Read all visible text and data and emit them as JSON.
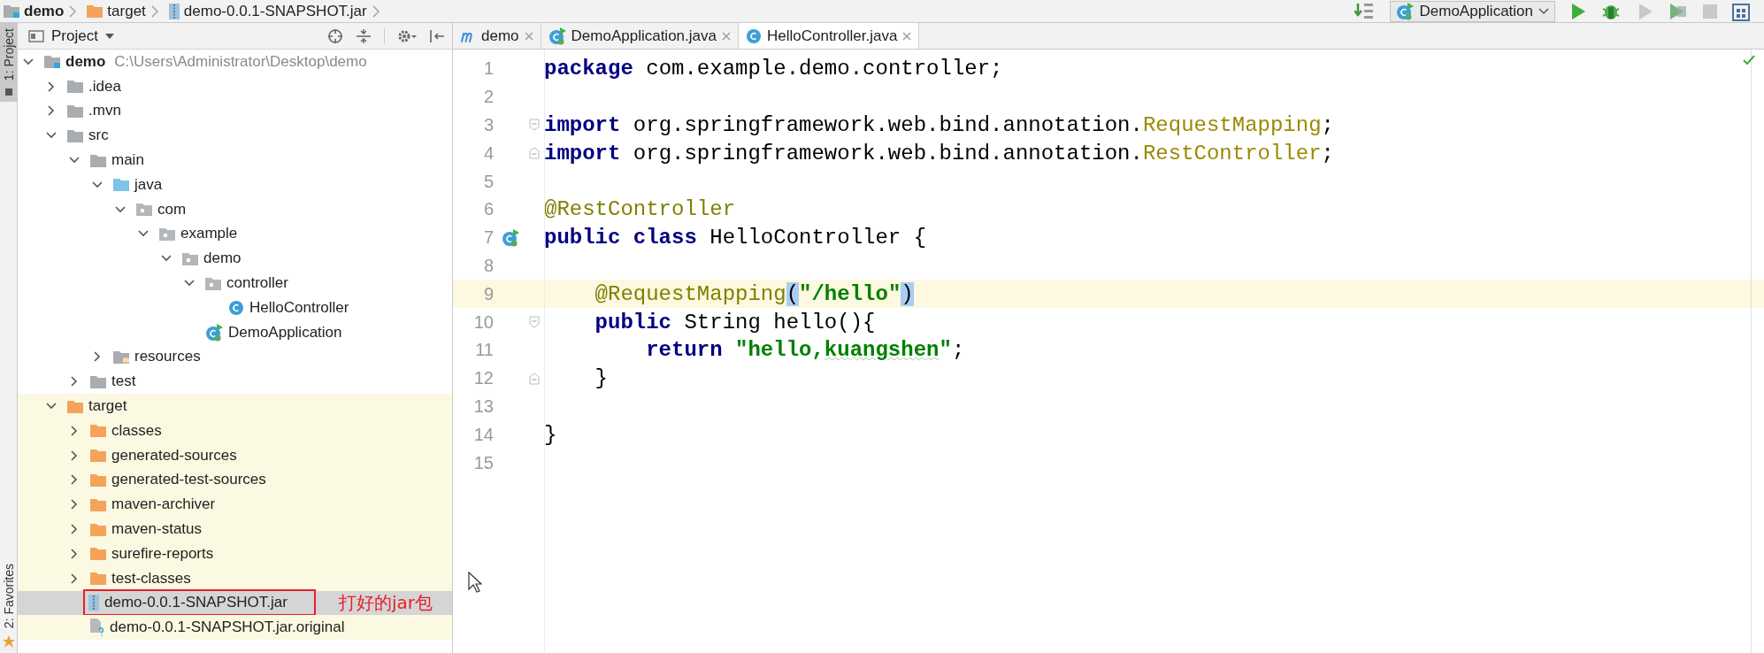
{
  "breadcrumbs": [
    {
      "label": "demo",
      "kind": "module"
    },
    {
      "label": "target",
      "kind": "excluded-folder"
    },
    {
      "label": "demo-0.0.1-SNAPSHOT.jar",
      "kind": "jar"
    }
  ],
  "run_config": {
    "label": "DemoApplication"
  },
  "toolbar_buttons": [
    {
      "kind": "build",
      "disabled": false
    },
    {
      "kind": "run",
      "disabled": false
    },
    {
      "kind": "debug",
      "disabled": false
    },
    {
      "kind": "run",
      "disabled": true
    },
    {
      "kind": "coverage",
      "disabled": false
    },
    {
      "kind": "stop",
      "disabled": true
    },
    {
      "kind": "structure",
      "disabled": false
    }
  ],
  "side_tabs": [
    {
      "label": "1: Project",
      "selected": true
    },
    {
      "label": "2: Favorites",
      "selected": false
    }
  ],
  "project_panel": {
    "title": "Project"
  },
  "project_tree": [
    {
      "label": "demo",
      "path": "C:\\Users\\Administrator\\Desktop\\demo",
      "kind": "module",
      "expanded": true,
      "selected": false,
      "children": [
        {
          "label": ".idea",
          "kind": "folder",
          "expanded": false,
          "selected": false
        },
        {
          "label": ".mvn",
          "kind": "folder",
          "expanded": false,
          "selected": false
        },
        {
          "label": "src",
          "kind": "folder",
          "expanded": true,
          "selected": false,
          "children": [
            {
              "label": "main",
              "kind": "folder",
              "expanded": true,
              "selected": false,
              "children": [
                {
                  "label": "java",
                  "kind": "source-folder",
                  "expanded": true,
                  "selected": false,
                  "children": [
                    {
                      "label": "com",
                      "kind": "package",
                      "expanded": true,
                      "selected": false,
                      "children": [
                        {
                          "label": "example",
                          "kind": "package",
                          "expanded": true,
                          "selected": false,
                          "children": [
                            {
                              "label": "demo",
                              "kind": "package",
                              "expanded": true,
                              "selected": false,
                              "children": [
                                {
                                  "label": "controller",
                                  "kind": "package",
                                  "expanded": true,
                                  "selected": false,
                                  "children": [
                                    {
                                      "label": "HelloController",
                                      "kind": "class",
                                      "selected": false
                                    }
                                  ]
                                },
                                {
                                  "label": "DemoApplication",
                                  "kind": "app-class",
                                  "selected": false
                                }
                              ]
                            }
                          ]
                        }
                      ]
                    }
                  ]
                },
                {
                  "label": "resources",
                  "kind": "resources-folder",
                  "expanded": false,
                  "selected": false
                }
              ]
            },
            {
              "label": "test",
              "kind": "folder",
              "expanded": false,
              "selected": false
            }
          ]
        },
        {
          "label": "target",
          "kind": "excluded-folder",
          "expanded": true,
          "selected": false,
          "children": [
            {
              "label": "classes",
              "kind": "excluded-folder",
              "expanded": false,
              "selected": false
            },
            {
              "label": "generated-sources",
              "kind": "excluded-folder",
              "expanded": false,
              "selected": false
            },
            {
              "label": "generated-test-sources",
              "kind": "excluded-folder",
              "expanded": false,
              "selected": false
            },
            {
              "label": "maven-archiver",
              "kind": "excluded-folder",
              "expanded": false,
              "selected": false
            },
            {
              "label": "maven-status",
              "kind": "excluded-folder",
              "expanded": false,
              "selected": false
            },
            {
              "label": "surefire-reports",
              "kind": "excluded-folder",
              "expanded": false,
              "selected": false
            },
            {
              "label": "test-classes",
              "kind": "excluded-folder",
              "expanded": false,
              "selected": false
            },
            {
              "label": "demo-0.0.1-SNAPSHOT.jar",
              "kind": "jar",
              "selected": true,
              "note": "打好的jar包"
            },
            {
              "label": "demo-0.0.1-SNAPSHOT.jar.original",
              "kind": "unknown-file",
              "selected": false
            }
          ]
        }
      ]
    }
  ],
  "editor_tabs": [
    {
      "label": "demo",
      "kind": "module-file",
      "selected": false
    },
    {
      "label": "DemoApplication.java",
      "kind": "app-class",
      "selected": false
    },
    {
      "label": "HelloController.java",
      "kind": "class",
      "selected": true
    }
  ],
  "code_lines": [
    {
      "number": "1",
      "tokens": [
        {
          "text": "package",
          "kind": "keyword"
        },
        {
          "text": " com.example.demo.controller;",
          "kind": "plain"
        }
      ]
    },
    {
      "number": "2"
    },
    {
      "number": "3",
      "kind": "fold-start",
      "tokens": [
        {
          "text": "import",
          "kind": "keyword"
        },
        {
          "text": " org.springframework.web.bind.annotation.",
          "kind": "plain"
        },
        {
          "text": "RequestMapping",
          "kind": "type-ref"
        },
        {
          "text": ";",
          "kind": "plain"
        }
      ]
    },
    {
      "number": "4",
      "kind": "fold-end",
      "tokens": [
        {
          "text": "import",
          "kind": "keyword"
        },
        {
          "text": " org.springframework.web.bind.annotation.",
          "kind": "plain"
        },
        {
          "text": "RestController",
          "kind": "type-ref"
        },
        {
          "text": ";",
          "kind": "plain"
        }
      ]
    },
    {
      "number": "5"
    },
    {
      "number": "6",
      "tokens": [
        {
          "text": "@RestController",
          "kind": "annotation"
        }
      ]
    },
    {
      "number": "7",
      "kind": "bean",
      "tokens": [
        {
          "text": "public class",
          "kind": "keyword"
        },
        {
          "text": " HelloController {",
          "kind": "plain"
        }
      ]
    },
    {
      "number": "8"
    },
    {
      "number": "9",
      "current": true,
      "tokens": [
        {
          "text": "    @RequestMapping",
          "kind": "annotation"
        },
        {
          "text": "(",
          "kind": "brace-match"
        },
        {
          "text": "\"/hello\"",
          "kind": "string"
        },
        {
          "text": ")",
          "kind": "brace-match"
        }
      ]
    },
    {
      "number": "10",
      "kind": "fold-start",
      "tokens": [
        {
          "text": "    public",
          "kind": "keyword"
        },
        {
          "text": " String hello(){",
          "kind": "plain"
        }
      ]
    },
    {
      "number": "11",
      "tokens": [
        {
          "text": "        return",
          "kind": "keyword"
        },
        {
          "text": " \"hello,",
          "kind": "string"
        },
        {
          "text": "kuangshen",
          "kind": "string-typo"
        },
        {
          "text": "\"",
          "kind": "string"
        },
        {
          "text": ";",
          "kind": "plain"
        }
      ]
    },
    {
      "number": "12",
      "kind": "fold-end",
      "tokens": [
        {
          "text": "    }",
          "kind": "plain"
        }
      ]
    },
    {
      "number": "13"
    },
    {
      "number": "14",
      "tokens": [
        {
          "text": "}",
          "kind": "plain"
        }
      ]
    },
    {
      "number": "15"
    }
  ]
}
